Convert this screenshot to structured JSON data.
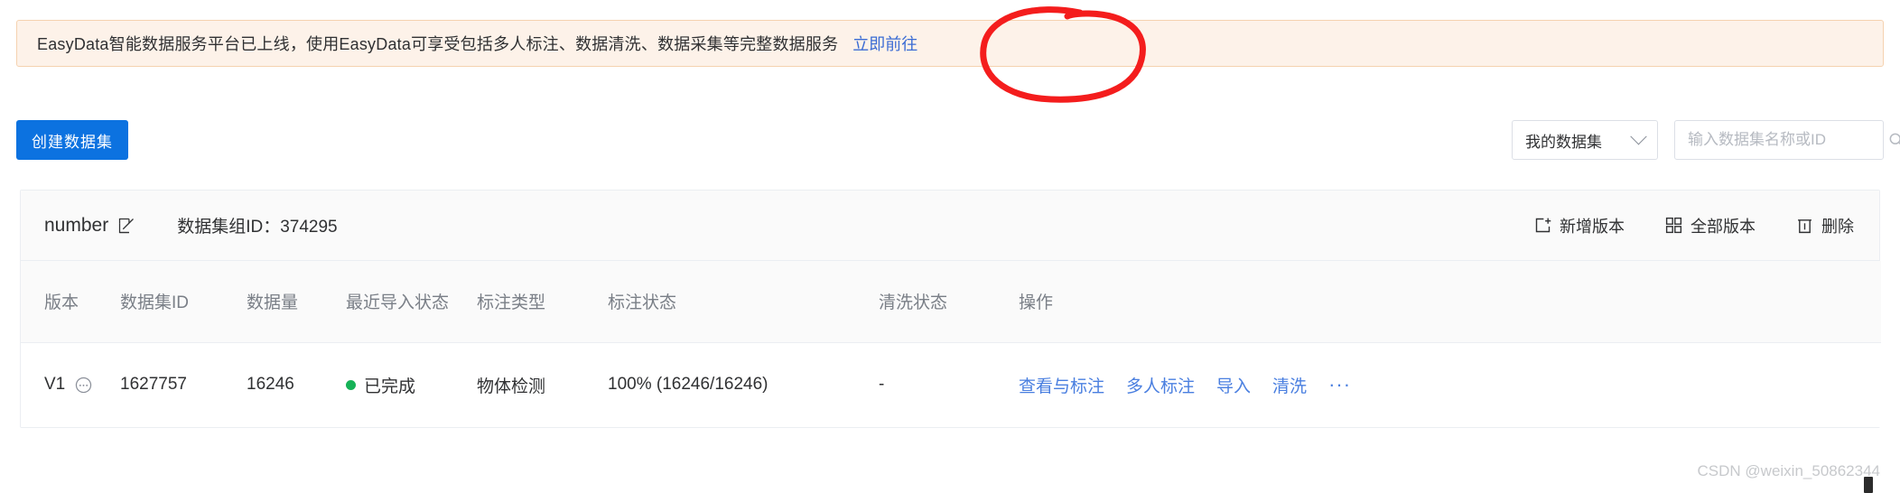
{
  "banner": {
    "message": "EasyData智能数据服务平台已上线，使用EasyData可享受包括多人标注、数据清洗、数据采集等完整数据服务",
    "link_label": "立即前往",
    "bg_color": "#fdf2e9",
    "border_color": "#f5d2b0",
    "link_color": "#3b6cd4"
  },
  "toolbar": {
    "create_label": "创建数据集",
    "create_bg": "#0c72e0",
    "filter": {
      "selected": "我的数据集",
      "icon": "chevron-down-icon"
    },
    "search": {
      "value": "",
      "placeholder": "输入数据集名称或ID",
      "icon": "search-icon"
    }
  },
  "card": {
    "header": {
      "dataset_name": "number",
      "edit_icon": "edit-square-icon",
      "group_id_label": "数据集组ID：374295",
      "actions": [
        {
          "label": "新增版本",
          "icon": "add-square-icon"
        },
        {
          "label": "全部版本",
          "icon": "grid-icon"
        },
        {
          "label": "删除",
          "icon": "trash-icon"
        }
      ]
    },
    "table": {
      "columns": [
        "版本",
        "数据集ID",
        "数据量",
        "最近导入状态",
        "标注类型",
        "标注状态",
        "清洗状态",
        "操作"
      ],
      "rows": [
        {
          "version": "V1",
          "version_icon": "ellipsis-circle-icon",
          "dataset_id": "1627757",
          "count": "16246",
          "import_status": "已完成",
          "import_status_color": "#16b257",
          "label_type": "物体检测",
          "label_status": "100% (16246/16246)",
          "clean_status": "-",
          "operations": [
            "查看与标注",
            "多人标注",
            "导入",
            "清洗"
          ],
          "operations_more": "···"
        }
      ]
    }
  },
  "annotation": {
    "shape": "red-ellipse-highlight",
    "color": "#f41d1d",
    "target": "立即前往"
  },
  "watermark": {
    "text": "CSDN @weixin_50862344"
  }
}
